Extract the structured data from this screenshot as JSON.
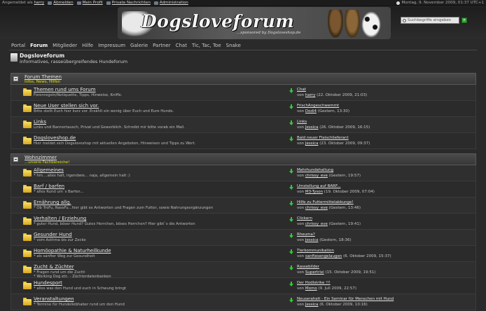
{
  "topbar": {
    "logged_in_prefix": "Angemeldet als",
    "username": "harry",
    "logout": "Abmelden",
    "profile": "Mein Profil",
    "messages": "Private Nachrichten",
    "admin": "Administration",
    "datetime": "Montag, 9. November 2009, 01:37 UTC+1"
  },
  "header": {
    "logo_text": "Dogsloveforum",
    "slogan": "...sponsored by Dogsloveshop.de",
    "search_placeholder": "Suchbegriffe eingeben",
    "search_go": "»"
  },
  "nav": [
    "Portal",
    "Forum",
    "Mitglieder",
    "Hilfe",
    "Impressum",
    "Galerie",
    "Partner",
    "Chat",
    "Tic, Tac, Toe",
    "Snake"
  ],
  "nav_active": 1,
  "forum": {
    "name": "Dogsloveforum",
    "subtitle": "informatives, rasseübergreifendes Hundeforum"
  },
  "categories": [
    {
      "name": "Forum Themen",
      "desc": "Infos, News, Hilfen",
      "boards": [
        {
          "name": "Themen rund ums Forum",
          "desc": "Forenregeln/Netiquette, Tipps, Hinweise, Kniffe.",
          "last_thread": "Chat",
          "by": "von",
          "user": "harry",
          "date": "(22. Oktober 2009, 21:03)"
        },
        {
          "name": "Neue User stellen sich vor.",
          "desc": "Bitte stellt Euch hier kurz vor. Erzählt ein wenig über Euch und Eure Hunde.",
          "last_thread": "FrischAngeschwemmt",
          "by": "von",
          "user": "Dodi4",
          "date": "(Gestern, 13:30)"
        },
        {
          "name": "Links",
          "desc": "Links und Bannertausch, Privat und Gewerblich. Schreibt mir bitte vorab ein Mail.",
          "last_thread": "Links",
          "by": "von",
          "user": "Jessica",
          "date": "(26. Oktober 2009, 16:15)"
        },
        {
          "name": "Dogsloveshop.de",
          "desc": "Hier meldet sich Dogsloveshop mit aktuellen Angeboten, Hinweisen und Tipps zu Wort.",
          "last_thread": "Bald neuer Fleischlieferant",
          "by": "von",
          "user": "Jessica",
          "date": "(23. Oktober 2009, 09:37)"
        }
      ]
    },
    {
      "name": "Wohnzimmer",
      "desc": "...unsere Fachbereiche!",
      "boards": [
        {
          "name": "Allgemeines",
          "desc": "* hm....alles halt, irgendwie... naja, allgemein halt :)",
          "last_thread": "Mehrhundehaltung",
          "by": "von",
          "user": "chrissy_eve",
          "date": "(Gestern, 19:57)"
        },
        {
          "name": "Barf / barfen",
          "desc": "* alles Rund um`s Barfen...",
          "last_thread": "Umstellung auf BARF...",
          "by": "von",
          "user": "M3-Tyson",
          "date": "(19. Oktober 2009, 07:04)"
        },
        {
          "name": "Ernährung allg.",
          "desc": "* Ob TroFu, NassFu...hier gibt es Antworten und Fragen zum Futter, sowie Nahrungsergänzungen",
          "last_thread": "Hilfe zu Futtermittelabkunge!",
          "by": "von",
          "user": "chrissy_eve",
          "date": "(Gestern, 13:46)"
        },
        {
          "name": "Verhalten / Erziehung",
          "desc": "* guter Hund, böser Hund? Gutes Herrchen, böses Herrchen? Hier gibt`s die Antworten",
          "last_thread": "Clickern",
          "by": "von",
          "user": "chrissy_eve",
          "date": "(Gestern, 19:41)"
        },
        {
          "name": "Gesunder Hund",
          "desc": "* vom Asthma bis zur Zecke",
          "last_thread": "Rheuma?",
          "by": "von",
          "user": "Jessica",
          "date": "(Gestern, 18:36)"
        },
        {
          "name": "Homöopathie & Naturheilkunde",
          "desc": "* als sanfter Weg zur Gesundheit",
          "last_thread": "Tierkommunikation",
          "by": "von",
          "user": "sanftesengelaugen",
          "date": "(6. Oktober 2009, 15:37)"
        },
        {
          "name": "Zucht & Züchter",
          "desc": "* Fragen rund um die Zucht\n* Working Dog etc. - Züchterdatenbanken",
          "last_thread": "Rassebilder",
          "by": "von",
          "user": "Supertrixi",
          "date": "(15. Oktober 2009, 19:51)"
        },
        {
          "name": "Hundesport",
          "desc": "* alles was den Hund und euch in Schwung bringt",
          "last_thread": "Der Hodlstrike !!!",
          "by": "von",
          "user": "Momo",
          "date": "(9. Juli 2009, 22:57)"
        },
        {
          "name": "Veranstaltungen",
          "desc": "* Termine für Hundeliebhaber rund um den Hund",
          "last_thread": "Neuseraheit - Ein Seminar für Menschen mit Hund",
          "by": "von",
          "user": "Jessica",
          "date": "(6. Oktober 2009, 10:16)"
        }
      ]
    }
  ]
}
